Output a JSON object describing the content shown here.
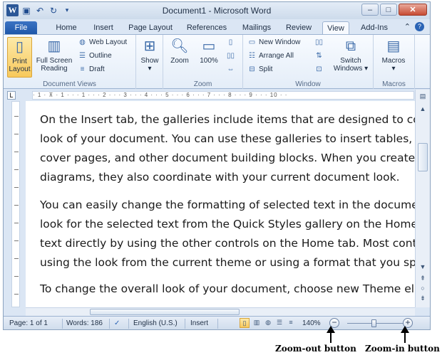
{
  "window": {
    "title": "Document1 - Microsoft Word",
    "logo": "W",
    "controls": {
      "minimize": "–",
      "maximize": "□",
      "close": "✕"
    },
    "qat_icons": [
      "save-icon",
      "undo-icon",
      "redo-icon",
      "customize-icon"
    ]
  },
  "tabs": [
    "File",
    "Home",
    "Insert",
    "Page Layout",
    "References",
    "Mailings",
    "Review",
    "View",
    "Add-Ins"
  ],
  "active_tab": "View",
  "ribbon": {
    "document_views": {
      "label": "Document Views",
      "print_layout": [
        "Print",
        "Layout"
      ],
      "full_screen_reading": [
        "Full Screen",
        "Reading"
      ],
      "web_layout": "Web Layout",
      "outline": "Outline",
      "draft": "Draft"
    },
    "show": {
      "label": "Show"
    },
    "zoom": {
      "label": "Zoom",
      "zoom_btn": "Zoom",
      "pct_btn": "100%"
    },
    "window": {
      "label": "Window",
      "new_window": "New Window",
      "arrange_all": "Arrange All",
      "split": "Split",
      "switch_windows": [
        "Switch",
        "Windows ▾"
      ]
    },
    "macros": {
      "label": "Macros",
      "macros_btn": [
        "Macros",
        "▾"
      ]
    }
  },
  "ruler": {
    "tab_marker": "L",
    "scale": "· 1 · ⊼ · 1 · · · 1 · · · 2 · · · 3 · · · 4 · · · 5 · · · 6 · · · 7 · · · 8 · · · 9 · · · 10 · ·"
  },
  "document": {
    "paragraphs": [
      [
        "On the Insert tab, the galleries include items that are designed to coo",
        "look of your document. You can use these galleries to insert tables, h",
        "cover pages, and other document building blocks. When you create p",
        "diagrams, they also coordinate with your current document look."
      ],
      [
        "You can easily change the formatting of selected text in the documen",
        "look for the selected text from the Quick Styles gallery on the Home t",
        "text directly by using the other controls on the Home tab. Most contr",
        "using the look from the current theme or using a format that you spe"
      ],
      [
        "To change the overall look of your document, choose new Theme ele"
      ]
    ]
  },
  "statusbar": {
    "page": "Page: 1 of 1",
    "words": "Words: 186",
    "language": "English (U.S.)",
    "mode": "Insert",
    "zoom_level": "140%",
    "zoom_out": "−",
    "zoom_in": "+"
  },
  "annotations": {
    "zoom_out_caption": "Zoom-out button",
    "zoom_in_caption": "Zoom-in button"
  }
}
